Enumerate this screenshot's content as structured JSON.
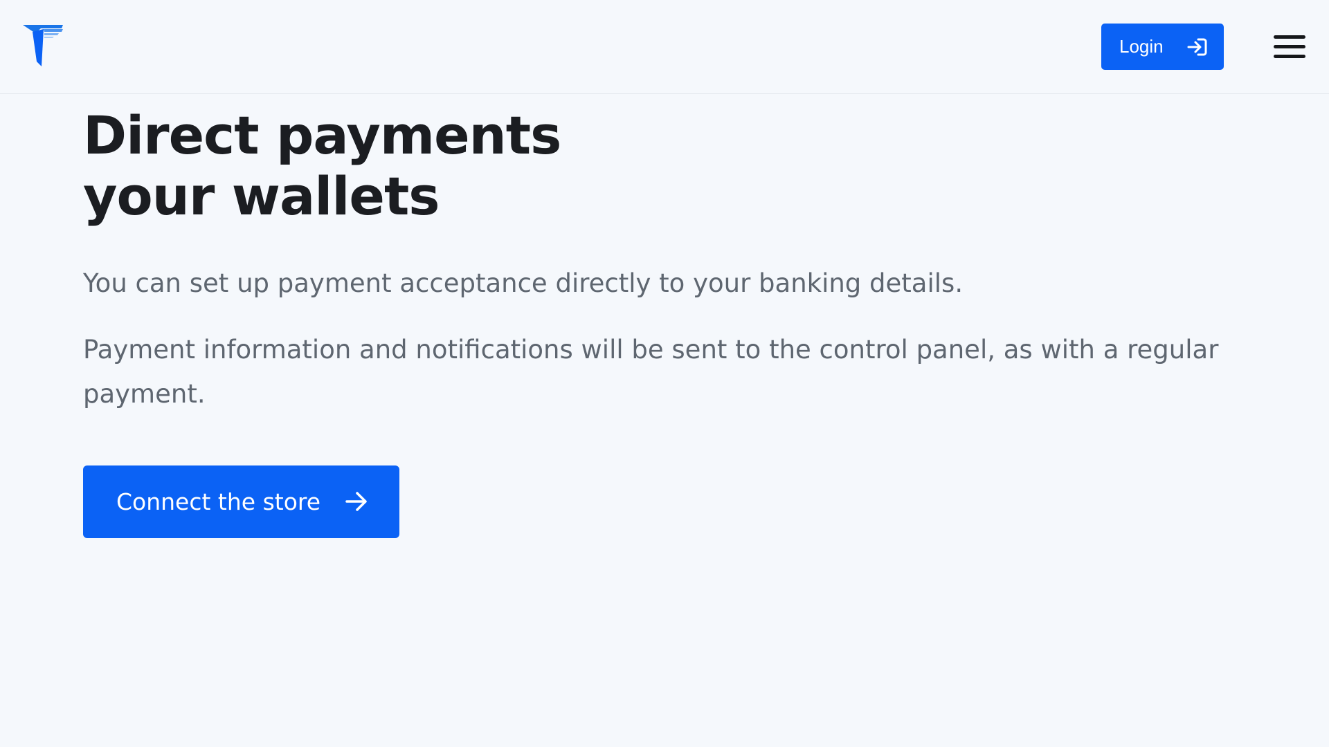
{
  "header": {
    "logo_icon": "brand-logo-icon",
    "login_label": "Login",
    "login_icon": "sign-in-icon",
    "menu_icon": "hamburger-menu-icon"
  },
  "hero": {
    "title_line_1": "Direct payments",
    "title_line_2": "your wallets",
    "paragraph_1": "You can set up payment acceptance directly to your banking details.",
    "paragraph_2": "Payment information and notifications will be sent to the control panel, as with a regular payment.",
    "cta_label": "Connect the store",
    "cta_icon": "arrow-right-icon"
  },
  "colors": {
    "accent": "#0b62f5",
    "background": "#f5f8fc",
    "heading": "#1b1d21",
    "body_text": "#5e6670"
  }
}
